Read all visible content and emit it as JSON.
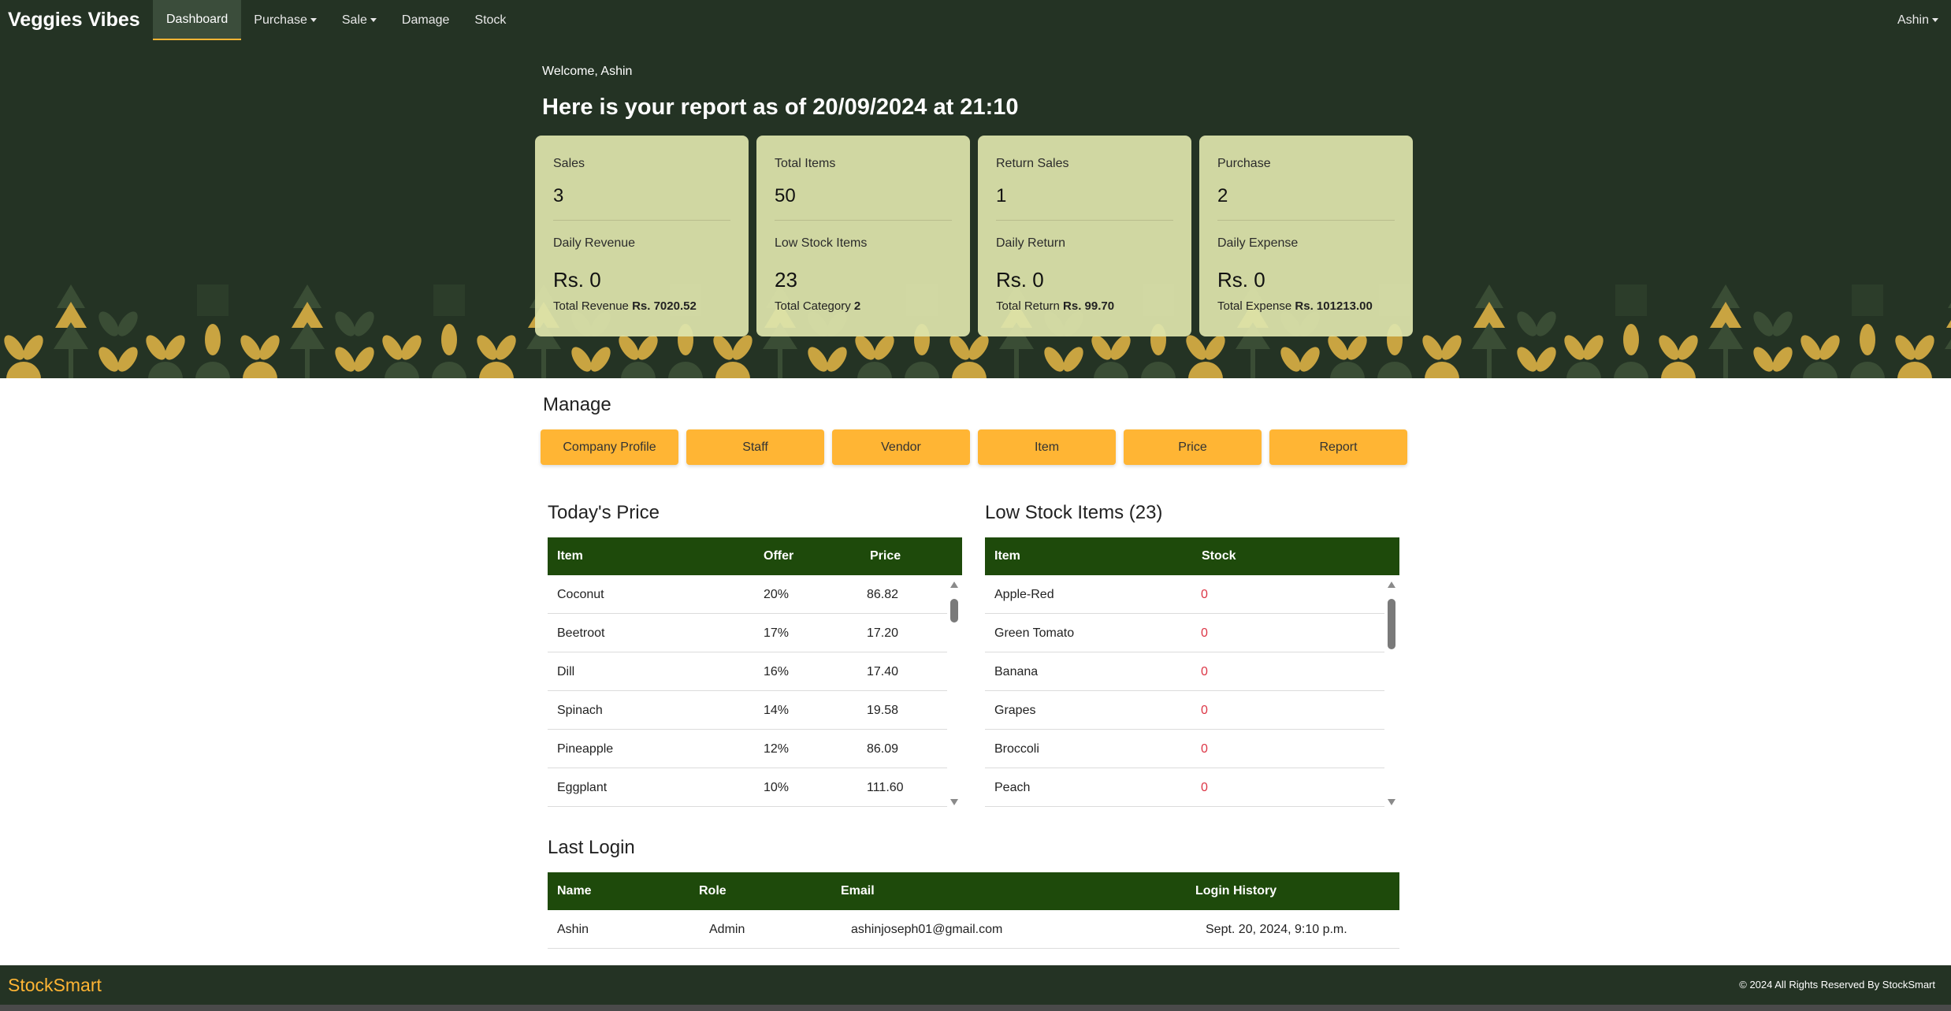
{
  "nav": {
    "brand": "Veggies Vibes",
    "items": [
      {
        "label": "Dashboard"
      },
      {
        "label": "Purchase"
      },
      {
        "label": "Sale"
      },
      {
        "label": "Damage"
      },
      {
        "label": "Stock"
      }
    ],
    "user": "Ashin"
  },
  "hero": {
    "welcome": "Welcome, Ashin",
    "title": "Here is your report as of 20/09/2024 at 21:10"
  },
  "cards": [
    {
      "top_label": "Sales",
      "top_value": "3",
      "mid_label": "Daily Revenue",
      "mid_value": "Rs. 0",
      "foot_label": "Total Revenue",
      "foot_value": "Rs. 7020.52"
    },
    {
      "top_label": "Total Items",
      "top_value": "50",
      "mid_label": "Low Stock Items",
      "mid_value": "23",
      "foot_label": "Total Category",
      "foot_value": "2"
    },
    {
      "top_label": "Return Sales",
      "top_value": "1",
      "mid_label": "Daily Return",
      "mid_value": "Rs. 0",
      "foot_label": "Total Return",
      "foot_value": "Rs. 99.70"
    },
    {
      "top_label": "Purchase",
      "top_value": "2",
      "mid_label": "Daily Expense",
      "mid_value": "Rs. 0",
      "foot_label": "Total Expense",
      "foot_value": "Rs. 101213.00"
    }
  ],
  "manage": {
    "title": "Manage",
    "buttons": [
      "Company Profile",
      "Staff",
      "Vendor",
      "Item",
      "Price",
      "Report"
    ]
  },
  "todays_price": {
    "title": "Today's Price",
    "headers": [
      "Item",
      "Offer",
      "Price"
    ],
    "rows": [
      [
        "Coconut",
        "20%",
        "86.82"
      ],
      [
        "Beetroot",
        "17%",
        "17.20"
      ],
      [
        "Dill",
        "16%",
        "17.40"
      ],
      [
        "Spinach",
        "14%",
        "19.58"
      ],
      [
        "Pineapple",
        "12%",
        "86.09"
      ],
      [
        "Eggplant",
        "10%",
        "111.60"
      ]
    ]
  },
  "low_stock": {
    "title": "Low Stock Items (23)",
    "headers": [
      "Item",
      "Stock"
    ],
    "rows": [
      [
        "Apple-Red",
        "0"
      ],
      [
        "Green Tomato",
        "0"
      ],
      [
        "Banana",
        "0"
      ],
      [
        "Grapes",
        "0"
      ],
      [
        "Broccoli",
        "0"
      ],
      [
        "Peach",
        "0"
      ]
    ]
  },
  "last_login": {
    "title": "Last Login",
    "headers": [
      "Name",
      "Role",
      "Email",
      "Login History"
    ],
    "rows": [
      [
        "Ashin",
        "Admin",
        "ashinjoseph01@gmail.com",
        "Sept. 20, 2024, 9:10 p.m."
      ]
    ]
  },
  "footer": {
    "logo": "StockSmart",
    "copyright": "© 2024 All Rights Reserved By StockSmart"
  },
  "colors": {
    "nav_bg": "#243324",
    "card_bg": "#dee4ac",
    "accent": "#ffb534",
    "table_header": "#1e4a0b",
    "stock_zero": "#dc3545"
  }
}
